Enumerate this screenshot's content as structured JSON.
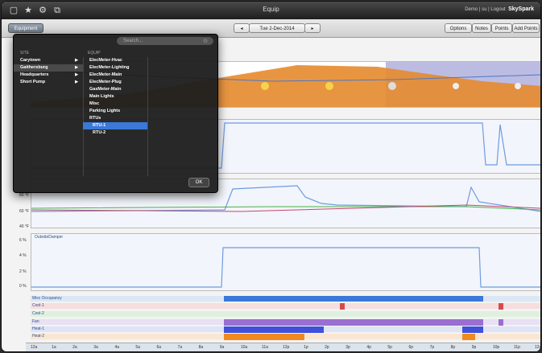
{
  "window": {
    "title": "Equip"
  },
  "header_links": {
    "demo": "Demo",
    "separator": "|",
    "user": "su",
    "logout": "Logout",
    "brand": "SkySpark"
  },
  "toolbar": {
    "equipment_tab": "Equipment",
    "date": "Tue 2-Dec-2014",
    "prev": "◂",
    "next": "▸",
    "buttons": [
      "Options",
      "Notes",
      "Points",
      "Add Points"
    ]
  },
  "picker": {
    "search_placeholder": "Search...",
    "site_header": "SITE",
    "equip_header": "EQUIP",
    "sites": [
      "Carytown",
      "Gaithersburg",
      "Headquarters",
      "Short Pump"
    ],
    "equip": [
      "ElecMeter-Hvac",
      "ElecMeter-Lighting",
      "ElecMeter-Main",
      "ElecMeter-Plug",
      "GasMeter-Main",
      "Main Lights",
      "Misc",
      "Parking Lights",
      "RTUs",
      "RTU-1",
      "RTU-2"
    ],
    "ok": "OK"
  },
  "charts": {
    "temp_ticks": [
      "80 °F",
      "60 °F",
      "40 °F"
    ],
    "damper_title": "OutsideDamper",
    "damper_ticks": [
      "6 %",
      "4 %",
      "2 %",
      "0 %"
    ]
  },
  "lanes": [
    "Misc Occupancy",
    "Cool-1",
    "Cool-2",
    "Fan",
    "Heat-1",
    "Heat-2"
  ],
  "time_axis": [
    "12a",
    "1a",
    "2a",
    "3a",
    "4a",
    "5a",
    "6a",
    "7a",
    "8a",
    "9a",
    "10a",
    "11a",
    "12p",
    "1p",
    "2p",
    "3p",
    "4p",
    "5p",
    "6p",
    "7p",
    "8p",
    "9p",
    "10p",
    "11p",
    "12a"
  ]
}
